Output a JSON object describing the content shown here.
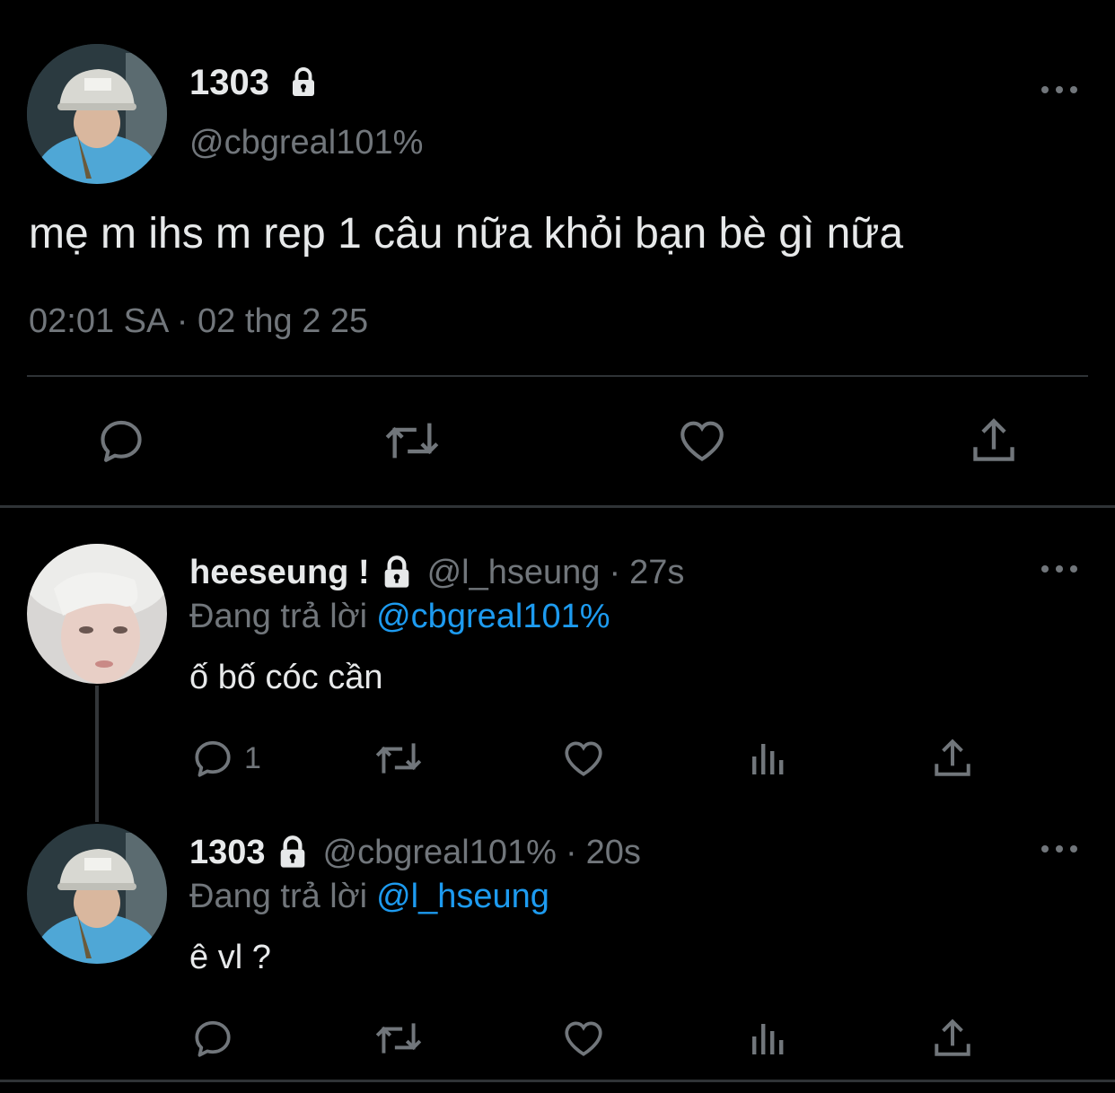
{
  "main_tweet": {
    "author_name": "1303",
    "handle": "@cbgreal101%",
    "text": "mẹ m ihs m rep 1 câu nữa khỏi bạn bè gì nữa",
    "timestamp": "02:01 SA · 02 thg 2 25"
  },
  "replies": [
    {
      "author_name": "heeseung !",
      "handle": "@l_hseung",
      "separator": "·",
      "time": "27s",
      "replying_label": "Đang trả lời",
      "replying_to": "@cbgreal101%",
      "text": "ố bố cóc cần",
      "reply_count": "1"
    },
    {
      "author_name": "1303",
      "handle": "@cbgreal101%",
      "separator": "·",
      "time": "20s",
      "replying_label": "Đang trả lời",
      "replying_to": "@l_hseung",
      "text": "ê vl ?",
      "reply_count": ""
    }
  ],
  "icons": {
    "reply": "reply-icon",
    "retweet": "retweet-icon",
    "like": "heart-icon",
    "views": "views-icon",
    "share": "share-icon",
    "more": "more-icon",
    "lock": "lock-icon"
  },
  "colors": {
    "background": "#000000",
    "text_primary": "#e7e9ea",
    "text_secondary": "#71767b",
    "mention": "#1d9bf0",
    "divider": "#2f3336"
  }
}
